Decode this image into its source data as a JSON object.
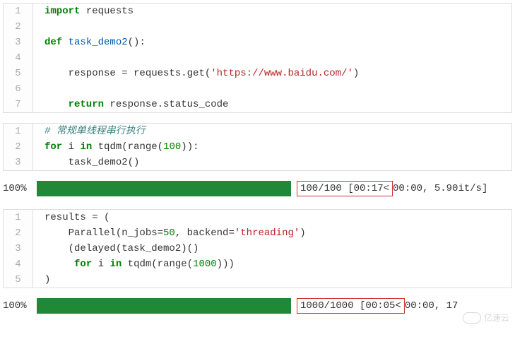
{
  "block1": {
    "l1_kw": "import",
    "l1_id": " requests",
    "l3_kw": "def",
    "l3_name": " task_demo2",
    "l3_paren": "():",
    "l5_id": "    response ",
    "l5_eq": "=",
    "l5_c1": " requests.get(",
    "l5_str": "'https://www.baidu.com/'",
    "l5_c2": ")",
    "l7_kw": "    return",
    "l7_rest": " response.status_code"
  },
  "block2": {
    "l1": "# 常规单线程串行执行",
    "l2_for": "for",
    "l2_i": " i ",
    "l2_in": "in",
    "l2_tq": " tqdm(range(",
    "l2_num": "100",
    "l2_end": ")):",
    "l3": "    task_demo2()"
  },
  "progress1": {
    "pct": "100%",
    "boxed": "100/100 [00:17<",
    "after": "00:00, 5.90it/s]"
  },
  "block3": {
    "l1": "results = (",
    "l2_a": "    Parallel(n_jobs=",
    "l2_num": "50",
    "l2_b": ", backend=",
    "l2_str": "'threading'",
    "l2_c": ")",
    "l3": "    (delayed(task_demo2)()",
    "l4_a": "     ",
    "l4_for": "for",
    "l4_i": " i ",
    "l4_in": "in",
    "l4_tq": " tqdm(range(",
    "l4_num": "1000",
    "l4_end": ")))",
    "l5": ")"
  },
  "progress2": {
    "pct": "100%",
    "boxed": "1000/1000 [00:05<",
    "after": "00:00, 17"
  },
  "watermark": "亿速云",
  "linenos": {
    "n1": "1",
    "n2": "2",
    "n3": "3",
    "n4": "4",
    "n5": "5",
    "n6": "6",
    "n7": "7"
  }
}
